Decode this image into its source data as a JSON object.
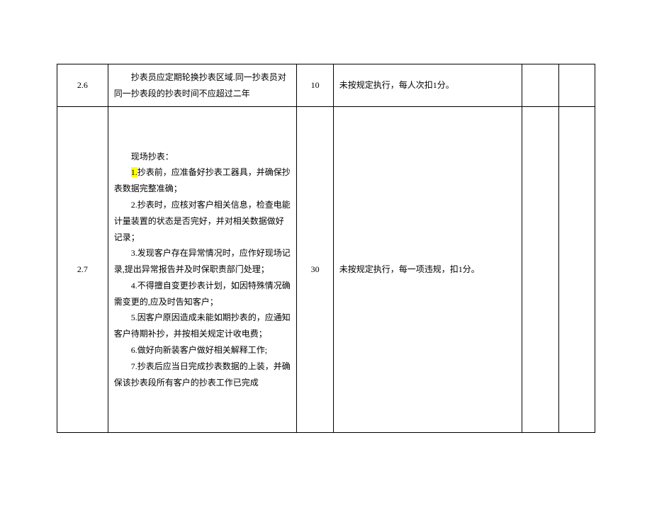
{
  "rows": [
    {
      "index": "2.6",
      "desc_lines": [
        "抄表员应定期轮换抄表区域.同一抄表员对同一抄表段的抄表时间不应超过二年"
      ],
      "score": "10",
      "rule": "未按规定执行，每人次扣1分。"
    },
    {
      "index": "2.7",
      "desc_title": "现场抄表：",
      "desc_item1_prefix": "1.",
      "desc_item1_rest": "抄表前，应准备好抄表工器具，并确保抄表数据完整准确；",
      "desc_items": [
        "2.抄表时，应核对客户相关信息，检查电能计量装置的状态是否完好，并对相关数据做好记录；",
        "3.发现客户存在异常情况时，应作好现场记录,提出异常报告并及时保职责部门处理；",
        "4.不得擅自变更抄表计划，如因特殊情况确需变更的,应及时告知客户；",
        "5.因客户原因造成未能如期抄表的，应通知客户待期补抄，并按相关规定计收电费；",
        "6.做好向新装客户做好相关解释工作;",
        "7.抄表后应当日完成抄表数据的上装，并确保该抄表段所有客户的抄表工作已完成"
      ],
      "score": "30",
      "rule": "未按规定执行，每一项违规，扣1分。"
    }
  ]
}
